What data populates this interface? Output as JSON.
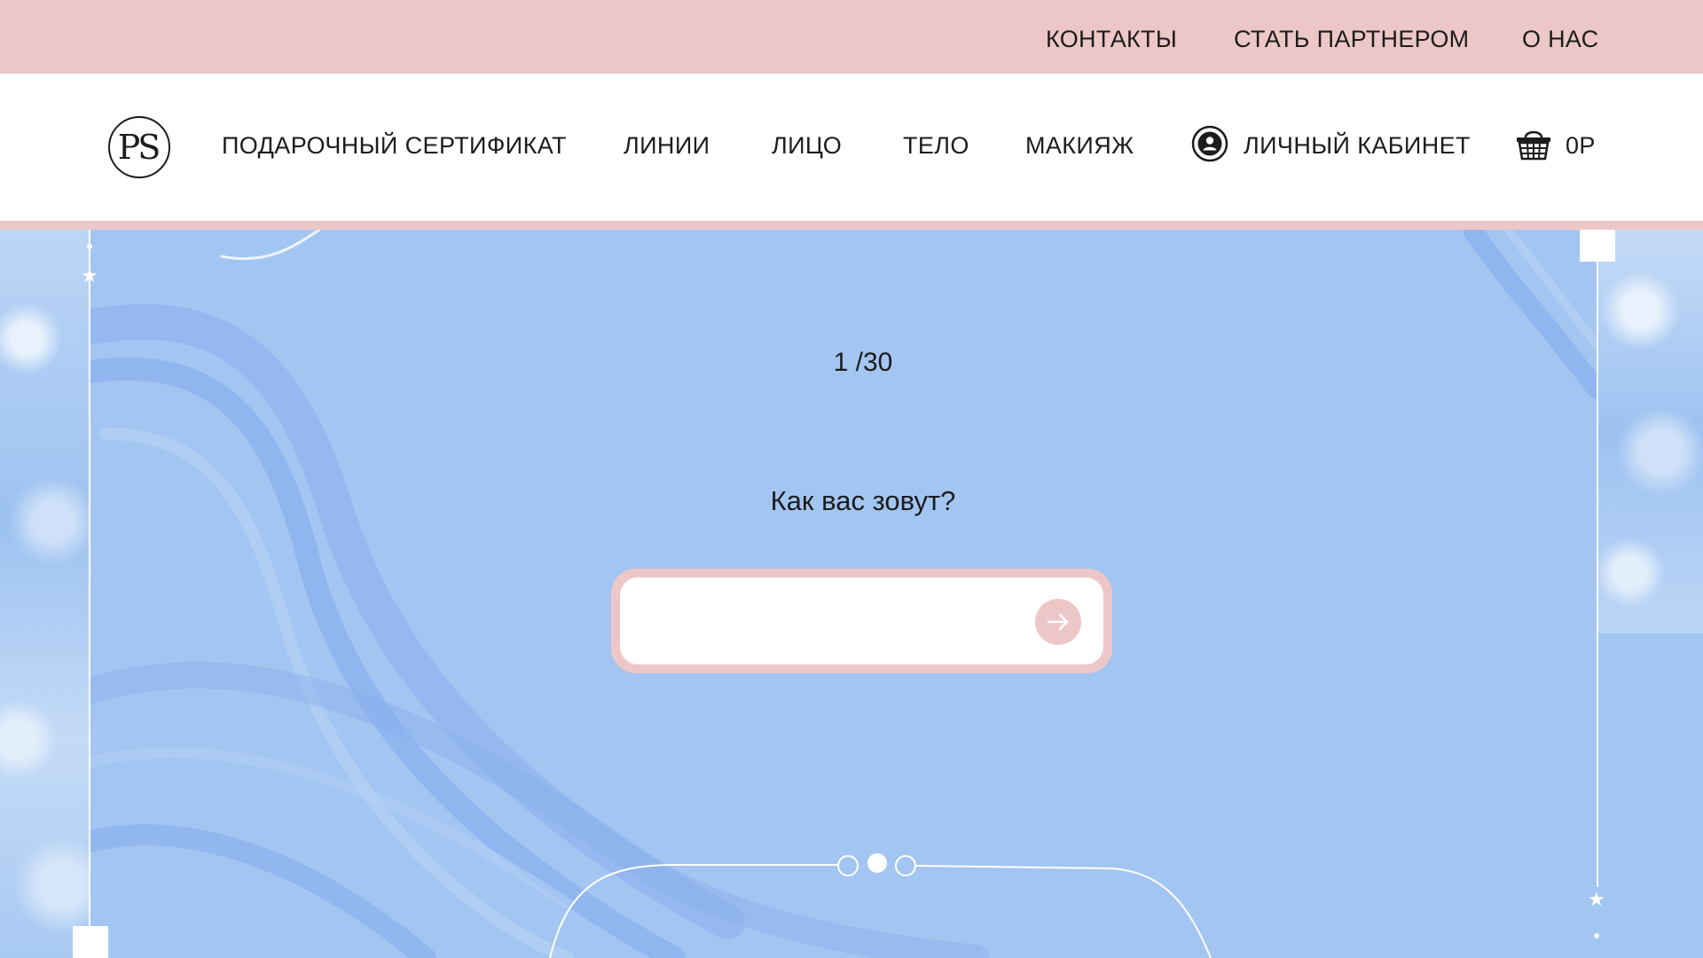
{
  "topbar": {
    "links": [
      "КОНТАКТЫ",
      "СТАТЬ ПАРТНЕРОМ",
      "О НАС"
    ]
  },
  "header": {
    "logo_text": "PS",
    "nav": [
      "ПОДАРОЧНЫЙ СЕРТИФИКАТ",
      "ЛИНИИ",
      "ЛИЦО",
      "ТЕЛО",
      "МАКИЯЖ"
    ],
    "account_label": "ЛИЧНЫЙ КАБИНЕТ",
    "account_icon": "user-circle-icon",
    "cart_total": "0Р",
    "cart_icon": "shopping-basket-icon"
  },
  "quiz": {
    "counter": "1 /30",
    "question": "Как вас зовут?",
    "input_value": "",
    "submit_icon": "arrow-right-icon"
  },
  "pager": {
    "count": 3,
    "active_index": 1
  },
  "colors": {
    "accent_pink": "#edc7c7",
    "hero_blue": "#a3c5f2",
    "text": "#1c1c1c"
  }
}
